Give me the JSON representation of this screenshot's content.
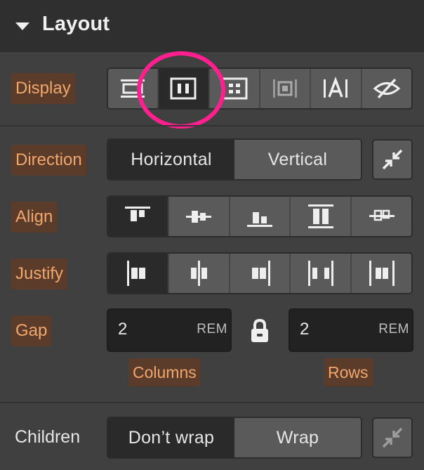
{
  "panel": {
    "title": "Layout",
    "caret_icon": "caret-down-icon"
  },
  "display": {
    "label": "Display",
    "options": [
      {
        "icon": "display-block-icon",
        "active": false
      },
      {
        "icon": "display-flex-icon",
        "active": true
      },
      {
        "icon": "display-grid-icon",
        "active": false
      },
      {
        "icon": "display-inline-block-icon",
        "active": false
      },
      {
        "icon": "display-inline-text-icon",
        "active": false
      },
      {
        "icon": "display-none-icon",
        "active": false
      }
    ]
  },
  "direction": {
    "label": "Direction",
    "options": [
      "Horizontal",
      "Vertical"
    ],
    "selected": "Horizontal",
    "reverse_icon": "reverse-arrows-icon"
  },
  "align": {
    "label": "Align",
    "options": [
      {
        "icon": "align-start-icon",
        "active": true
      },
      {
        "icon": "align-center-icon",
        "active": false
      },
      {
        "icon": "align-end-icon",
        "active": false
      },
      {
        "icon": "align-stretch-icon",
        "active": false
      },
      {
        "icon": "align-baseline-icon",
        "active": false
      }
    ]
  },
  "justify": {
    "label": "Justify",
    "options": [
      {
        "icon": "justify-start-icon",
        "active": true
      },
      {
        "icon": "justify-center-icon",
        "active": false
      },
      {
        "icon": "justify-end-icon",
        "active": false
      },
      {
        "icon": "justify-space-between-icon",
        "active": false
      },
      {
        "icon": "justify-space-around-icon",
        "active": false
      }
    ]
  },
  "gap": {
    "label": "Gap",
    "columns": {
      "value": "2",
      "unit": "REM",
      "label": "Columns"
    },
    "rows": {
      "value": "2",
      "unit": "REM",
      "label": "Rows"
    },
    "lock_icon": "lock-icon"
  },
  "children": {
    "label": "Children",
    "options": [
      "Don’t wrap",
      "Wrap"
    ],
    "selected": "Don’t wrap",
    "reverse_icon": "reverse-arrows-icon"
  },
  "colors": {
    "highlight_ring": "#ff1f8e",
    "label_text": "#f2a76c",
    "label_bg": "#5b3b2a"
  }
}
